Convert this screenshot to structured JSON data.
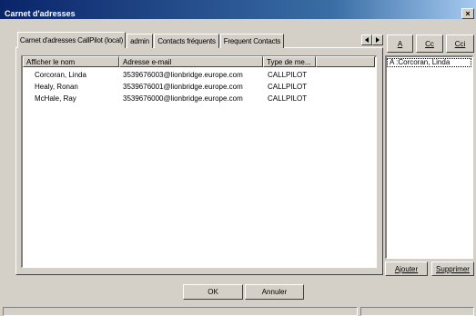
{
  "window": {
    "title": "Carnet d'adresses",
    "close_glyph": "×"
  },
  "tabs": [
    {
      "label": "Carnet d'adresses CallPilot (local)",
      "active": true
    },
    {
      "label": "admin",
      "active": false
    },
    {
      "label": "Contacts fréquents",
      "active": false
    },
    {
      "label": "Frequent Contacts",
      "active": false
    }
  ],
  "list": {
    "columns": [
      "Afficher le nom",
      "Adresse e-mail",
      "Type de me...",
      ""
    ],
    "rows": [
      {
        "name": "Corcoran, Linda",
        "email": "3539676003@lionbridge.europe.com",
        "type": "CALLPILOT"
      },
      {
        "name": "Healy, Ronan",
        "email": "3539676001@lionbridge.europe.com",
        "type": "CALLPILOT"
      },
      {
        "name": "McHale, Ray",
        "email": "3539676000@lionbridge.europe.com",
        "type": "CALLPILOT"
      }
    ]
  },
  "recipients": {
    "buttons": {
      "to": "A",
      "cc": "Cc",
      "bcc": "Cci"
    },
    "items": [
      "A :Corcoran, Linda"
    ],
    "add_label": "Ajouter",
    "delete_label": "Supprimer"
  },
  "footer": {
    "ok_label": "OK",
    "cancel_label": "Annuler"
  },
  "icons": {
    "close": "close-icon",
    "scroll_left": "triangle-left-icon",
    "scroll_right": "triangle-right-icon"
  }
}
